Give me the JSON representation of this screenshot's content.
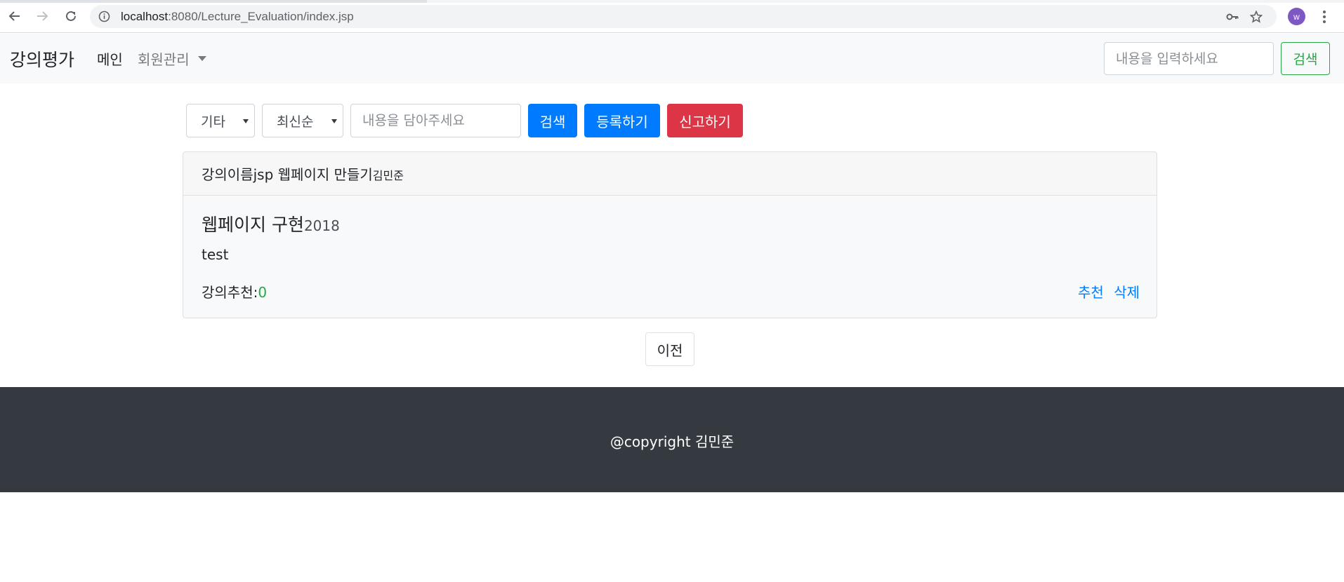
{
  "browser": {
    "url_host": "localhost",
    "url_rest": ":8080/Lecture_Evaluation/index.jsp",
    "avatar_letter": "w",
    "icons": [
      "back-arrow-icon",
      "forward-arrow-icon",
      "reload-icon",
      "info-icon",
      "key-icon",
      "star-icon",
      "kebab-menu-icon"
    ]
  },
  "navbar": {
    "brand": "강의평가",
    "main_link": "메인",
    "member_menu": "회원관리",
    "search_placeholder": "내용을 입력하세요",
    "search_button": "검색",
    "search_button_color": "#28a745"
  },
  "filters": {
    "category_selected": "기타",
    "sort_selected": "최신순",
    "search_placeholder": "내용을 담아주세요",
    "search_button": "검색",
    "register_button": "등록하기",
    "report_button": "신고하기",
    "primary_color": "#007bff",
    "danger_color": "#dc3545"
  },
  "evaluation": {
    "header_prefix": "강의이름",
    "lecture_name": "jsp 웹페이지 만들기",
    "professor": "김민준",
    "title": "웹페이지 구현",
    "year": "2018",
    "content": "test",
    "recommend_label": "강의추천:",
    "recommend_count": "0",
    "recommend_link": "추천",
    "delete_link": "삭제"
  },
  "pagination": {
    "prev_label": "이전"
  },
  "footer": {
    "copyright": "@copyright 김민준",
    "background": "#343a40"
  }
}
